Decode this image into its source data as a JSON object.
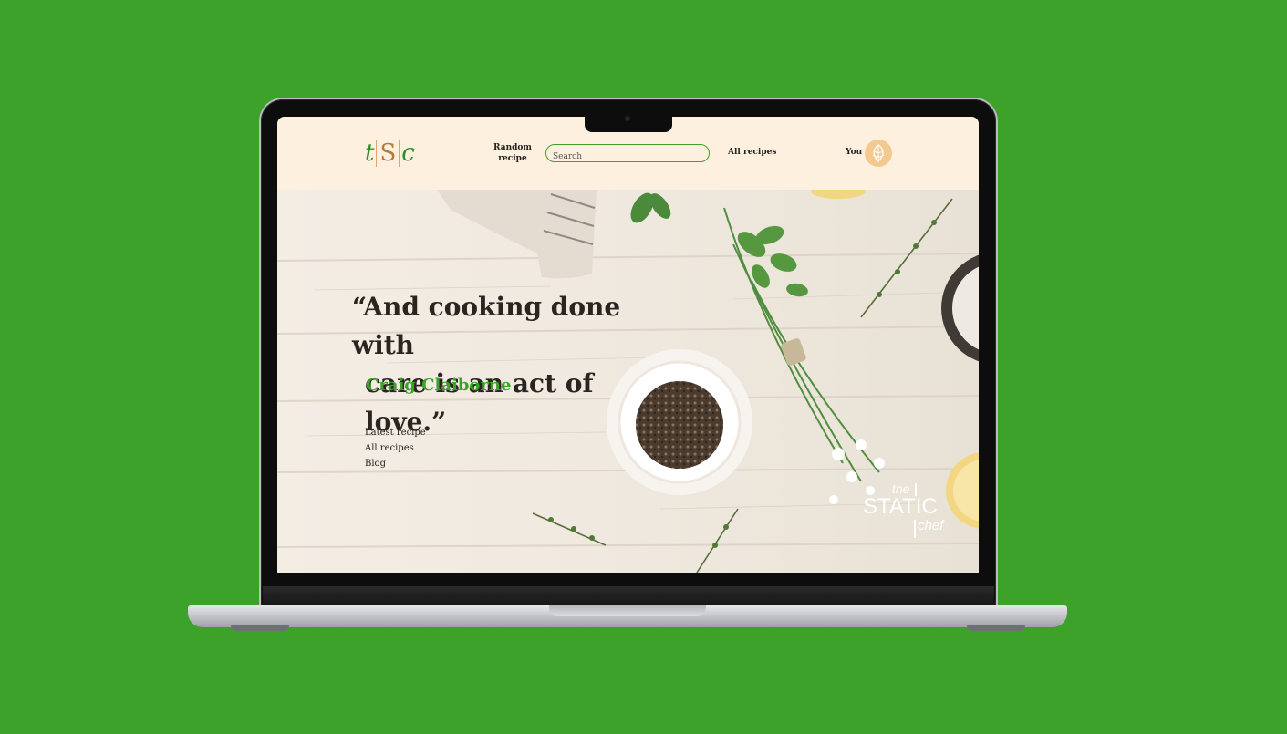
{
  "header": {
    "logo": {
      "part1": "t",
      "part2": "S",
      "part3": "c"
    },
    "nav_random_line1": "Random",
    "nav_random_line2": "recipe",
    "search_placeholder": "Search",
    "nav_all_recipes": "All recipes",
    "nav_you": "You"
  },
  "hero": {
    "quote_line1": "“And cooking done with",
    "quote_line2": "care is an act of love.”",
    "author": "Craig Claiborne",
    "links": [
      "Latest recipe",
      "All recipes",
      "Blog"
    ],
    "brand": {
      "the": "the",
      "static": "STATIC",
      "chef": "chef"
    }
  },
  "colors": {
    "background": "#3da22a",
    "header_bg": "#fdf0de",
    "accent_green": "#3da22a",
    "accent_orange": "#b97839"
  }
}
